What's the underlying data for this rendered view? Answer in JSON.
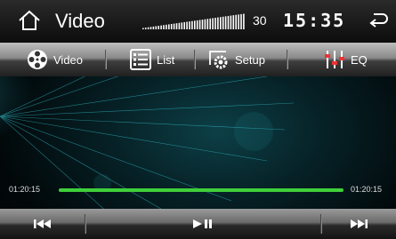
{
  "header": {
    "title": "Video",
    "volume_level": 30,
    "volume_display": "30",
    "clock": "15:35",
    "icons": {
      "home": "home-icon",
      "back": "back-icon"
    }
  },
  "menu": {
    "items": [
      {
        "label": "Video",
        "icon": "film-reel-icon"
      },
      {
        "label": "List",
        "icon": "list-icon"
      },
      {
        "label": "Setup",
        "icon": "settings-gear-icon"
      },
      {
        "label": "EQ",
        "icon": "equalizer-icon"
      }
    ]
  },
  "playback": {
    "elapsed": "01:20:15",
    "total": "01:20:15",
    "progress_percent": 100
  },
  "controls": {
    "previous": "previous-icon",
    "play_pause": "play-pause-icon",
    "next": "next-icon"
  },
  "colors": {
    "progress": "#3fcf3a",
    "accent_rays": "#37d3e0"
  }
}
